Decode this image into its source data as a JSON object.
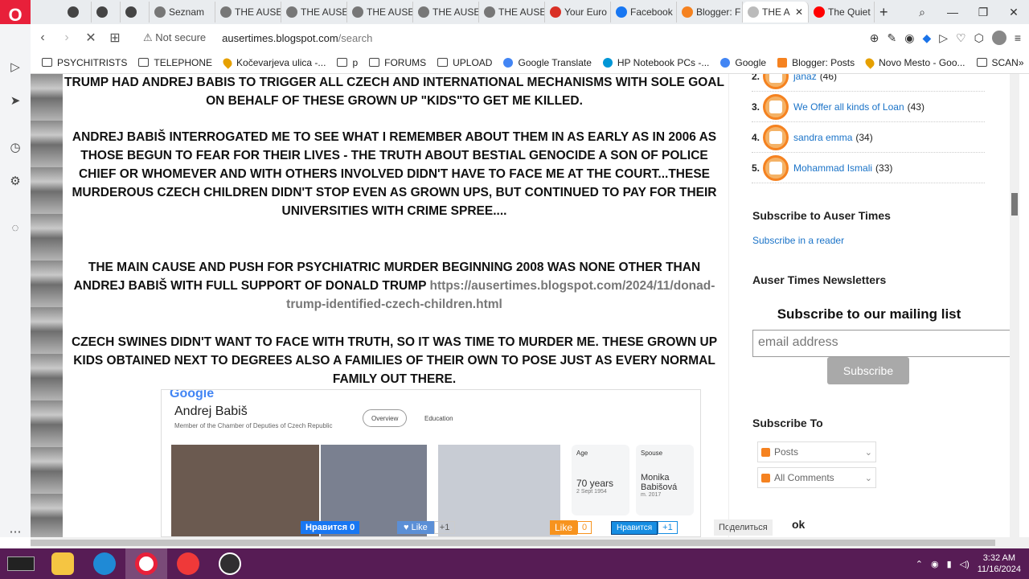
{
  "tabs": [
    {
      "label": "",
      "icon": "vpn-icon"
    },
    {
      "label": "",
      "icon": "vpn-icon"
    },
    {
      "label": "",
      "icon": "vpn-icon"
    },
    {
      "label": "Seznam",
      "icon": "globe-icon"
    },
    {
      "label": "THE AUSE",
      "icon": "globe-icon"
    },
    {
      "label": "THE AUSE",
      "icon": "globe-icon"
    },
    {
      "label": "THE AUSE",
      "icon": "globe-icon"
    },
    {
      "label": "THE AUSE",
      "icon": "globe-icon"
    },
    {
      "label": "THE AUSE",
      "icon": "globe-icon"
    },
    {
      "label": "Your Euro",
      "icon": "gmail-icon"
    },
    {
      "label": "Facebook",
      "icon": "facebook-icon"
    },
    {
      "label": "Blogger: F",
      "icon": "blogger-icon"
    },
    {
      "label": "THE A",
      "icon": "loading-icon",
      "active": true
    },
    {
      "label": "The Quiet",
      "icon": "youtube-icon"
    }
  ],
  "address": {
    "security": "Not secure",
    "host": "ausertimes.blogspot.com",
    "path": "/search"
  },
  "bookmarks": [
    {
      "label": "PSYCHITRISTS",
      "icon": "folder"
    },
    {
      "label": "TELEPHONE",
      "icon": "folder"
    },
    {
      "label": "Kočevarjeva ulica -...",
      "icon": "pin"
    },
    {
      "label": "p",
      "icon": "folder"
    },
    {
      "label": "FORUMS",
      "icon": "folder"
    },
    {
      "label": "UPLOAD",
      "icon": "folder"
    },
    {
      "label": "Google Translate",
      "icon": "g"
    },
    {
      "label": "HP Notebook PCs -...",
      "icon": "hp"
    },
    {
      "label": "Google",
      "icon": "g"
    },
    {
      "label": "Blogger: Posts",
      "icon": "b"
    },
    {
      "label": "Novo Mesto - Goo...",
      "icon": "pin"
    },
    {
      "label": "SCAN",
      "icon": "folder"
    }
  ],
  "article": {
    "p1": "TRUMP HAD ANDREJ BABIS TO TRIGGER ALL CZECH AND INTERNATIONAL MECHANISMS WITH SOLE GOAL ON BEHALF OF THESE GROWN UP \"KIDS\"TO GET ME KILLED.",
    "p2": "ANDREJ BABIŠ INTERROGATED ME TO SEE WHAT I REMEMBER ABOUT THEM IN AS EARLY AS IN 2006 AS THOSE BEGUN TO FEAR FOR THEIR LIVES - THE TRUTH ABOUT BESTIAL GENOCIDE A SON OF POLICE CHIEF OR WHOMEVER AND WITH OTHERS INVOLVED DIDN'T HAVE TO FACE ME AT THE COURT...THESE MURDEROUS CZECH CHILDREN DIDN'T STOP EVEN AS GROWN UPS, BUT CONTINUED TO PAY FOR THEIR UNIVERSITIES WITH CRIME SPREE....",
    "p3": "THE MAIN CAUSE AND PUSH FOR PSYCHIATRIC MURDER BEGINNING 2008 WAS NONE OTHER THAN ANDREJ BABIŠ WITH FULL SUPPORT OF DONALD TRUMP",
    "p3_link": "https://ausertimes.blogspot.com/2024/11/donad-trump-identified-czech-children.html",
    "p4": "CZECH SWINES DIDN'T WANT TO FACE WITH TRUTH, SO IT WAS TIME TO MURDER ME. THESE GROWN UP KIDS OBTAINED NEXT TO DEGREES ALSO A FAMILIES OF THEIR OWN TO POSE JUST AS EVERY NORMAL FAMILY OUT THERE."
  },
  "image_card": {
    "logo": "Google",
    "name": "Andrej Babiš",
    "subtitle": "Member of the Chamber of Deputies of Czech Republic",
    "chip1": "Overview",
    "chip2": "Education",
    "age_label": "Age",
    "age_value": "70 years",
    "age_sub": "2 Sept 1954",
    "spouse_label": "Spouse",
    "spouse_value": "Monika Babišová",
    "spouse_sub": "m. 2017"
  },
  "share": {
    "vk_like": "Нравится",
    "vk_count": "0",
    "fb_like": "Like",
    "fb_count": "+1",
    "ok_like": "Like",
    "ok_count": "0",
    "mail_like": "Нравится",
    "mail_count": "+1",
    "share": "Поделиться",
    "overflow": "ok"
  },
  "ranking": [
    {
      "num": "2.",
      "name": "janaz",
      "count": "(46)"
    },
    {
      "num": "3.",
      "name": "We Offer all kinds of Loan",
      "count": "(43)"
    },
    {
      "num": "4.",
      "name": "sandra emma",
      "count": "(34)"
    },
    {
      "num": "5.",
      "name": "Mohammad Ismali",
      "count": "(33)"
    }
  ],
  "widgets": {
    "subscribe_title": "Subscribe to Auser Times",
    "subscribe_link": "Subscribe in a reader",
    "newsletter_title": "Auser Times Newsletters",
    "mailing_title": "Subscribe to our mailing list",
    "email_placeholder": "email address",
    "subscribe_button": "Subscribe",
    "subscribe_to_title": "Subscribe To",
    "feed1": "Posts",
    "feed2": "All Comments"
  },
  "taskbar": {
    "time": "3:32 AM",
    "date": "11/16/2024"
  }
}
